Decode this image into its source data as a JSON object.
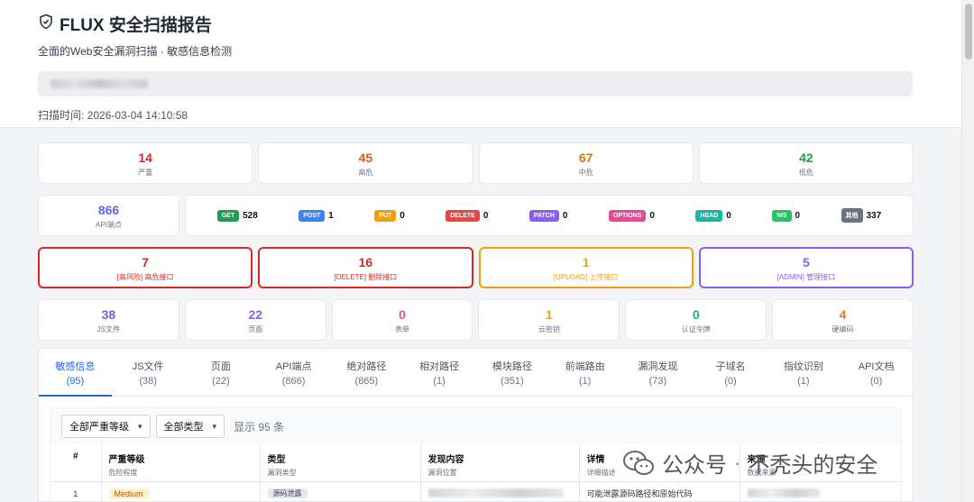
{
  "header": {
    "title": "FLUX 安全扫描报告",
    "subtitle": "全面的Web安全漏洞扫描 · 敏感信息检测",
    "scan_time": "扫描时间: 2026-03-04 14:10:58"
  },
  "severity": [
    {
      "num": "14",
      "label": "严重",
      "color": "#dc2626"
    },
    {
      "num": "45",
      "label": "高危",
      "color": "#ea580c"
    },
    {
      "num": "67",
      "label": "中危",
      "color": "#d97706"
    },
    {
      "num": "42",
      "label": "低危",
      "color": "#16a34a"
    }
  ],
  "api": {
    "total": "866",
    "total_label": "API端点",
    "methods": [
      {
        "tag": "GET",
        "count": "528",
        "color": "#16a34a"
      },
      {
        "tag": "POST",
        "count": "1",
        "color": "#3b82f6"
      },
      {
        "tag": "PUT",
        "count": "0",
        "color": "#f59e0b"
      },
      {
        "tag": "DELETE",
        "count": "0",
        "color": "#ef4444"
      },
      {
        "tag": "PATCH",
        "count": "0",
        "color": "#8b5cf6"
      },
      {
        "tag": "OPTIONS",
        "count": "0",
        "color": "#ec4899"
      },
      {
        "tag": "HEAD",
        "count": "0",
        "color": "#14b8a6"
      },
      {
        "tag": "WS",
        "count": "0",
        "color": "#22c55e"
      },
      {
        "tag": "其他",
        "count": "337",
        "color": "#6b7280"
      }
    ]
  },
  "risk": [
    {
      "num": "7",
      "label": "[高风险] 高危接口",
      "color": "#dc2626"
    },
    {
      "num": "16",
      "label": "[DELETE] 删除接口",
      "color": "#dc2626"
    },
    {
      "num": "1",
      "label": "[UPLOAD] 上传接口",
      "color": "#f59e0b"
    },
    {
      "num": "5",
      "label": "[ADMIN] 管理接口",
      "color": "#8b5cf6"
    }
  ],
  "resources": [
    {
      "num": "38",
      "label": "JS文件",
      "color": "#6366f1"
    },
    {
      "num": "22",
      "label": "页面",
      "color": "#8b5cf6"
    },
    {
      "num": "0",
      "label": "表单",
      "color": "#ec4899"
    },
    {
      "num": "1",
      "label": "云密钥",
      "color": "#f59e0b"
    },
    {
      "num": "0",
      "label": "认证令牌",
      "color": "#10b981"
    },
    {
      "num": "4",
      "label": "硬编码",
      "color": "#f97316"
    }
  ],
  "tabs": [
    {
      "label": "敏感信息",
      "count": "(95)"
    },
    {
      "label": "JS文件",
      "count": "(38)"
    },
    {
      "label": "页面",
      "count": "(22)"
    },
    {
      "label": "API端点",
      "count": "(866)"
    },
    {
      "label": "绝对路径",
      "count": "(865)"
    },
    {
      "label": "相对路径",
      "count": "(1)"
    },
    {
      "label": "模块路径",
      "count": "(351)"
    },
    {
      "label": "前端路由",
      "count": "(1)"
    },
    {
      "label": "漏洞发现",
      "count": "(73)"
    },
    {
      "label": "子域名",
      "count": "(0)"
    },
    {
      "label": "指纹识别",
      "count": "(1)"
    },
    {
      "label": "API文档",
      "count": "(0)"
    }
  ],
  "filters": {
    "severity_select": "全部严重等级",
    "type_select": "全部类型",
    "count_text": "显示 95 条"
  },
  "table": {
    "headers": [
      {
        "title": "#",
        "sub": ""
      },
      {
        "title": "严重等级",
        "sub": "危险程度"
      },
      {
        "title": "类型",
        "sub": "漏洞类型"
      },
      {
        "title": "发现内容",
        "sub": "漏洞位置"
      },
      {
        "title": "详情",
        "sub": "详细描述"
      },
      {
        "title": "来源",
        "sub": "数据来源"
      }
    ],
    "row1": {
      "index": "1",
      "severity": "Medium",
      "type": "源码泄露",
      "detail": "可能泄露源码路径和原始代码"
    }
  },
  "watermark": {
    "brand": "公众号",
    "separator": "·",
    "name": "不秃头的安全"
  }
}
